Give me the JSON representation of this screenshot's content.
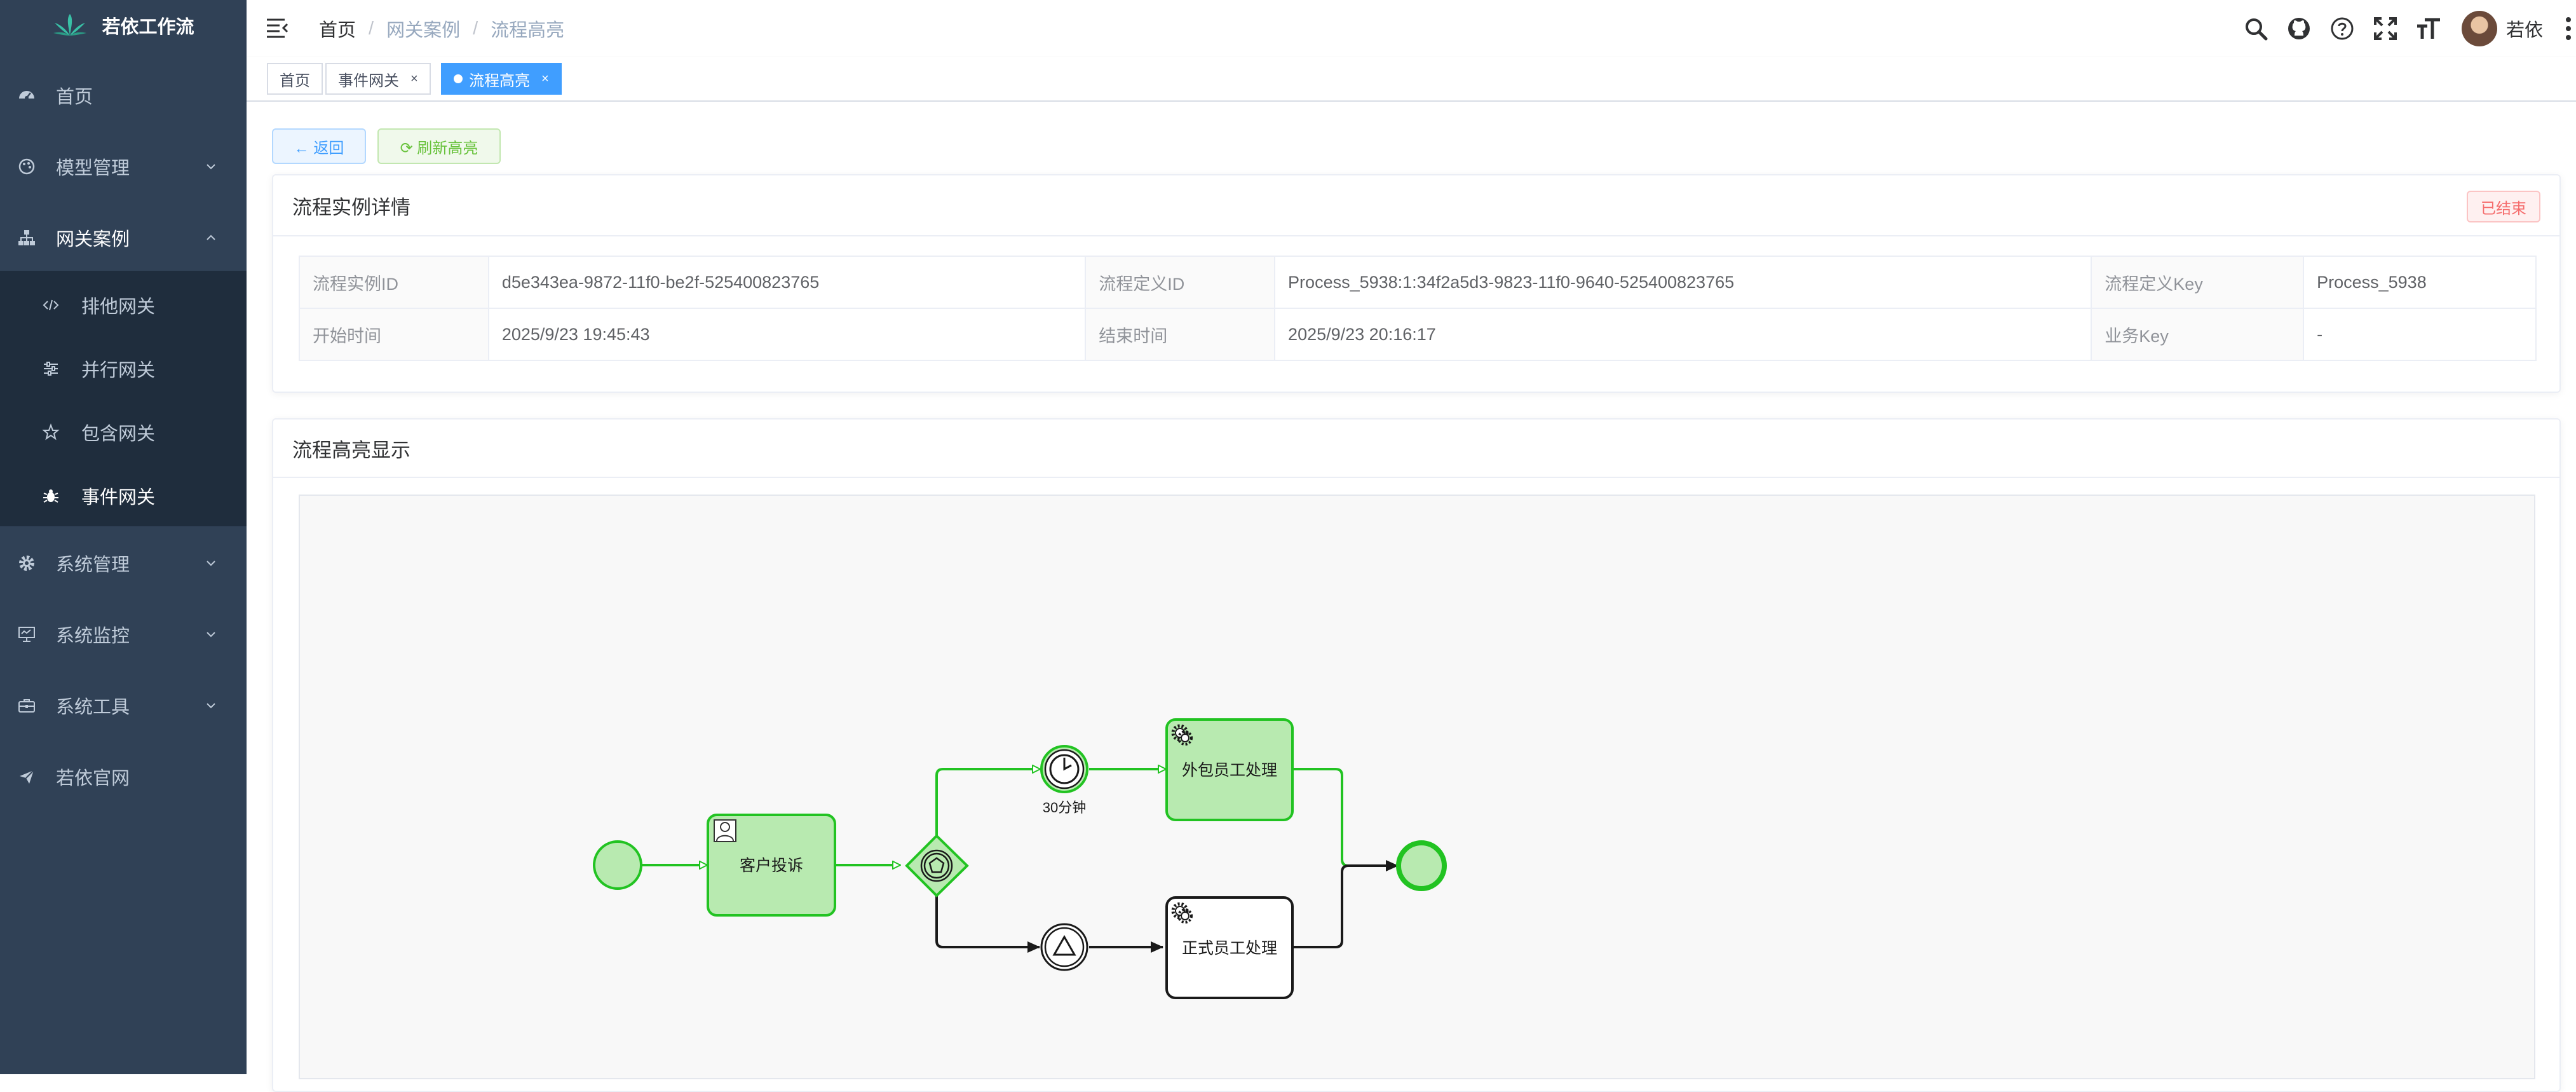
{
  "app": {
    "title": "若依工作流"
  },
  "sidebar": {
    "items": [
      {
        "label": "首页",
        "icon": "dashboard-icon"
      },
      {
        "label": "模型管理",
        "icon": "palette-icon"
      },
      {
        "label": "网关案例",
        "icon": "tree-icon"
      },
      {
        "label": "系统管理",
        "icon": "gear-icon"
      },
      {
        "label": "系统监控",
        "icon": "monitor-icon"
      },
      {
        "label": "系统工具",
        "icon": "toolbox-icon"
      },
      {
        "label": "若依官网",
        "icon": "send-icon"
      }
    ],
    "subitems": [
      {
        "label": "排他网关",
        "icon": "code-icon"
      },
      {
        "label": "并行网关",
        "icon": "sliders-icon"
      },
      {
        "label": "包含网关",
        "icon": "star-icon"
      },
      {
        "label": "事件网关",
        "icon": "bug-icon"
      }
    ]
  },
  "breadcrumb": [
    "首页",
    "网关案例",
    "流程高亮"
  ],
  "user": {
    "name": "若依"
  },
  "tags": [
    {
      "label": "首页",
      "active": false
    },
    {
      "label": "事件网关",
      "active": false,
      "close": "×"
    },
    {
      "label": "流程高亮",
      "active": true,
      "close": "×"
    }
  ],
  "buttons": {
    "back": "← 返回",
    "refresh": "⟳ 刷新高亮"
  },
  "detail": {
    "title": "流程实例详情",
    "status": "已结束",
    "rows": [
      [
        {
          "label": "流程实例ID",
          "value": "d5e343ea-9872-11f0-be2f-525400823765"
        },
        {
          "label": "流程定义ID",
          "value": "Process_5938:1:34f2a5d3-9823-11f0-9640-525400823765"
        },
        {
          "label": "流程定义Key",
          "value": "Process_5938"
        }
      ],
      [
        {
          "label": "开始时间",
          "value": "2025/9/23 19:45:43"
        },
        {
          "label": "结束时间",
          "value": "2025/9/23 20:16:17"
        },
        {
          "label": "业务Key",
          "value": "-"
        }
      ]
    ]
  },
  "diagram": {
    "title": "流程高亮显示",
    "tasks": {
      "customer_complaint": "客户投诉",
      "outsourced": "外包员工处理",
      "regular": "正式员工处理"
    },
    "timer_label": "30分钟"
  },
  "colors": {
    "highlight": "#22c322",
    "highlight_fill": "#b8eab0",
    "sidebar_bg": "#304156",
    "submenu_bg": "#1f2d3d",
    "tag_active": "#409eff"
  }
}
